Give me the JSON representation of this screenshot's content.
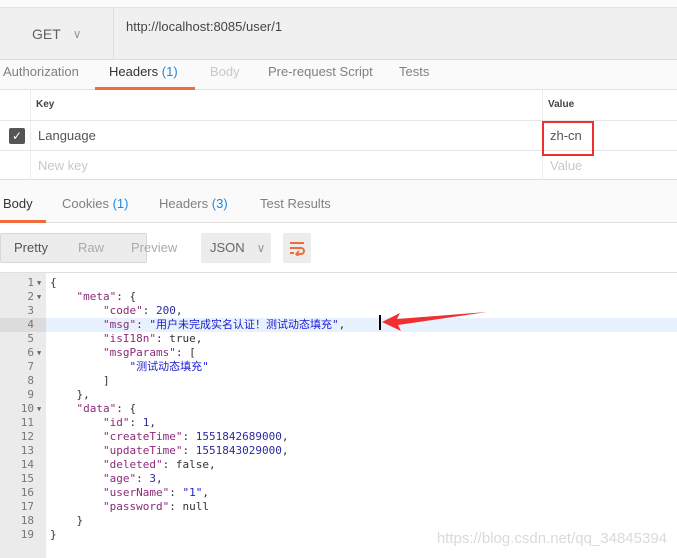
{
  "request": {
    "method": "GET",
    "url": "http://localhost:8085/user/1"
  },
  "request_tabs": [
    {
      "label": "Authorization"
    },
    {
      "label": "Headers",
      "count": "(1)",
      "active": true
    },
    {
      "label": "Body",
      "disabled": true
    },
    {
      "label": "Pre-request Script"
    },
    {
      "label": "Tests"
    }
  ],
  "headers_table": {
    "columns": [
      "Key",
      "Value"
    ],
    "rows": [
      {
        "checked": true,
        "key": "Language",
        "value": "zh-cn"
      }
    ],
    "new_key_placeholder": "New key",
    "new_value_placeholder": "Value"
  },
  "response_tabs": [
    {
      "label": "Body",
      "active": true
    },
    {
      "label": "Cookies",
      "count": "(1)"
    },
    {
      "label": "Headers",
      "count": "(3)"
    },
    {
      "label": "Test Results"
    }
  ],
  "view_modes": [
    "Pretty",
    "Raw",
    "Preview"
  ],
  "selected_view": "Pretty",
  "format": "JSON",
  "colors": {
    "accent": "#f26b3a",
    "highlight_box": "#f03030",
    "count": "#1e88e5"
  },
  "code_lines": [
    {
      "fold": true,
      "tokens": [
        [
          "p",
          "{"
        ]
      ]
    },
    {
      "fold": true,
      "tokens": [
        [
          "p",
          "    "
        ],
        [
          "k",
          "\"meta\""
        ],
        [
          "p",
          ": {"
        ]
      ]
    },
    {
      "tokens": [
        [
          "p",
          "        "
        ],
        [
          "k",
          "\"code\""
        ],
        [
          "p",
          ": "
        ],
        [
          "n",
          "200"
        ],
        [
          "p",
          ","
        ]
      ]
    },
    {
      "current": true,
      "tokens": [
        [
          "p",
          "        "
        ],
        [
          "k",
          "\"msg\""
        ],
        [
          "p",
          ": "
        ],
        [
          "s",
          "\"用户未完成实名认证！测试动态填充\""
        ],
        [
          "p",
          ","
        ]
      ]
    },
    {
      "tokens": [
        [
          "p",
          "        "
        ],
        [
          "k",
          "\"isI18n\""
        ],
        [
          "p",
          ": "
        ],
        [
          "b",
          "true"
        ],
        [
          "p",
          ","
        ]
      ]
    },
    {
      "fold": true,
      "tokens": [
        [
          "p",
          "        "
        ],
        [
          "k",
          "\"msgParams\""
        ],
        [
          "p",
          ": ["
        ]
      ]
    },
    {
      "tokens": [
        [
          "p",
          "            "
        ],
        [
          "s",
          "\"测试动态填充\""
        ]
      ]
    },
    {
      "tokens": [
        [
          "p",
          "        ]"
        ]
      ]
    },
    {
      "tokens": [
        [
          "p",
          "    },"
        ]
      ]
    },
    {
      "fold": true,
      "tokens": [
        [
          "p",
          "    "
        ],
        [
          "k",
          "\"data\""
        ],
        [
          "p",
          ": {"
        ]
      ]
    },
    {
      "tokens": [
        [
          "p",
          "        "
        ],
        [
          "k",
          "\"id\""
        ],
        [
          "p",
          ": "
        ],
        [
          "n",
          "1"
        ],
        [
          "p",
          ","
        ]
      ]
    },
    {
      "tokens": [
        [
          "p",
          "        "
        ],
        [
          "k",
          "\"createTime\""
        ],
        [
          "p",
          ": "
        ],
        [
          "n",
          "1551842689000"
        ],
        [
          "p",
          ","
        ]
      ]
    },
    {
      "tokens": [
        [
          "p",
          "        "
        ],
        [
          "k",
          "\"updateTime\""
        ],
        [
          "p",
          ": "
        ],
        [
          "n",
          "1551843029000"
        ],
        [
          "p",
          ","
        ]
      ]
    },
    {
      "tokens": [
        [
          "p",
          "        "
        ],
        [
          "k",
          "\"deleted\""
        ],
        [
          "p",
          ": "
        ],
        [
          "b",
          "false"
        ],
        [
          "p",
          ","
        ]
      ]
    },
    {
      "tokens": [
        [
          "p",
          "        "
        ],
        [
          "k",
          "\"age\""
        ],
        [
          "p",
          ": "
        ],
        [
          "n",
          "3"
        ],
        [
          "p",
          ","
        ]
      ]
    },
    {
      "tokens": [
        [
          "p",
          "        "
        ],
        [
          "k",
          "\"userName\""
        ],
        [
          "p",
          ": "
        ],
        [
          "s",
          "\"1\""
        ],
        [
          "p",
          ","
        ]
      ]
    },
    {
      "tokens": [
        [
          "p",
          "        "
        ],
        [
          "k",
          "\"password\""
        ],
        [
          "p",
          ": "
        ],
        [
          "b",
          "null"
        ]
      ]
    },
    {
      "tokens": [
        [
          "p",
          "    }"
        ]
      ]
    },
    {
      "tokens": [
        [
          "p",
          "}"
        ]
      ]
    }
  ],
  "watermark": "https://blog.csdn.net/qq_34845394"
}
